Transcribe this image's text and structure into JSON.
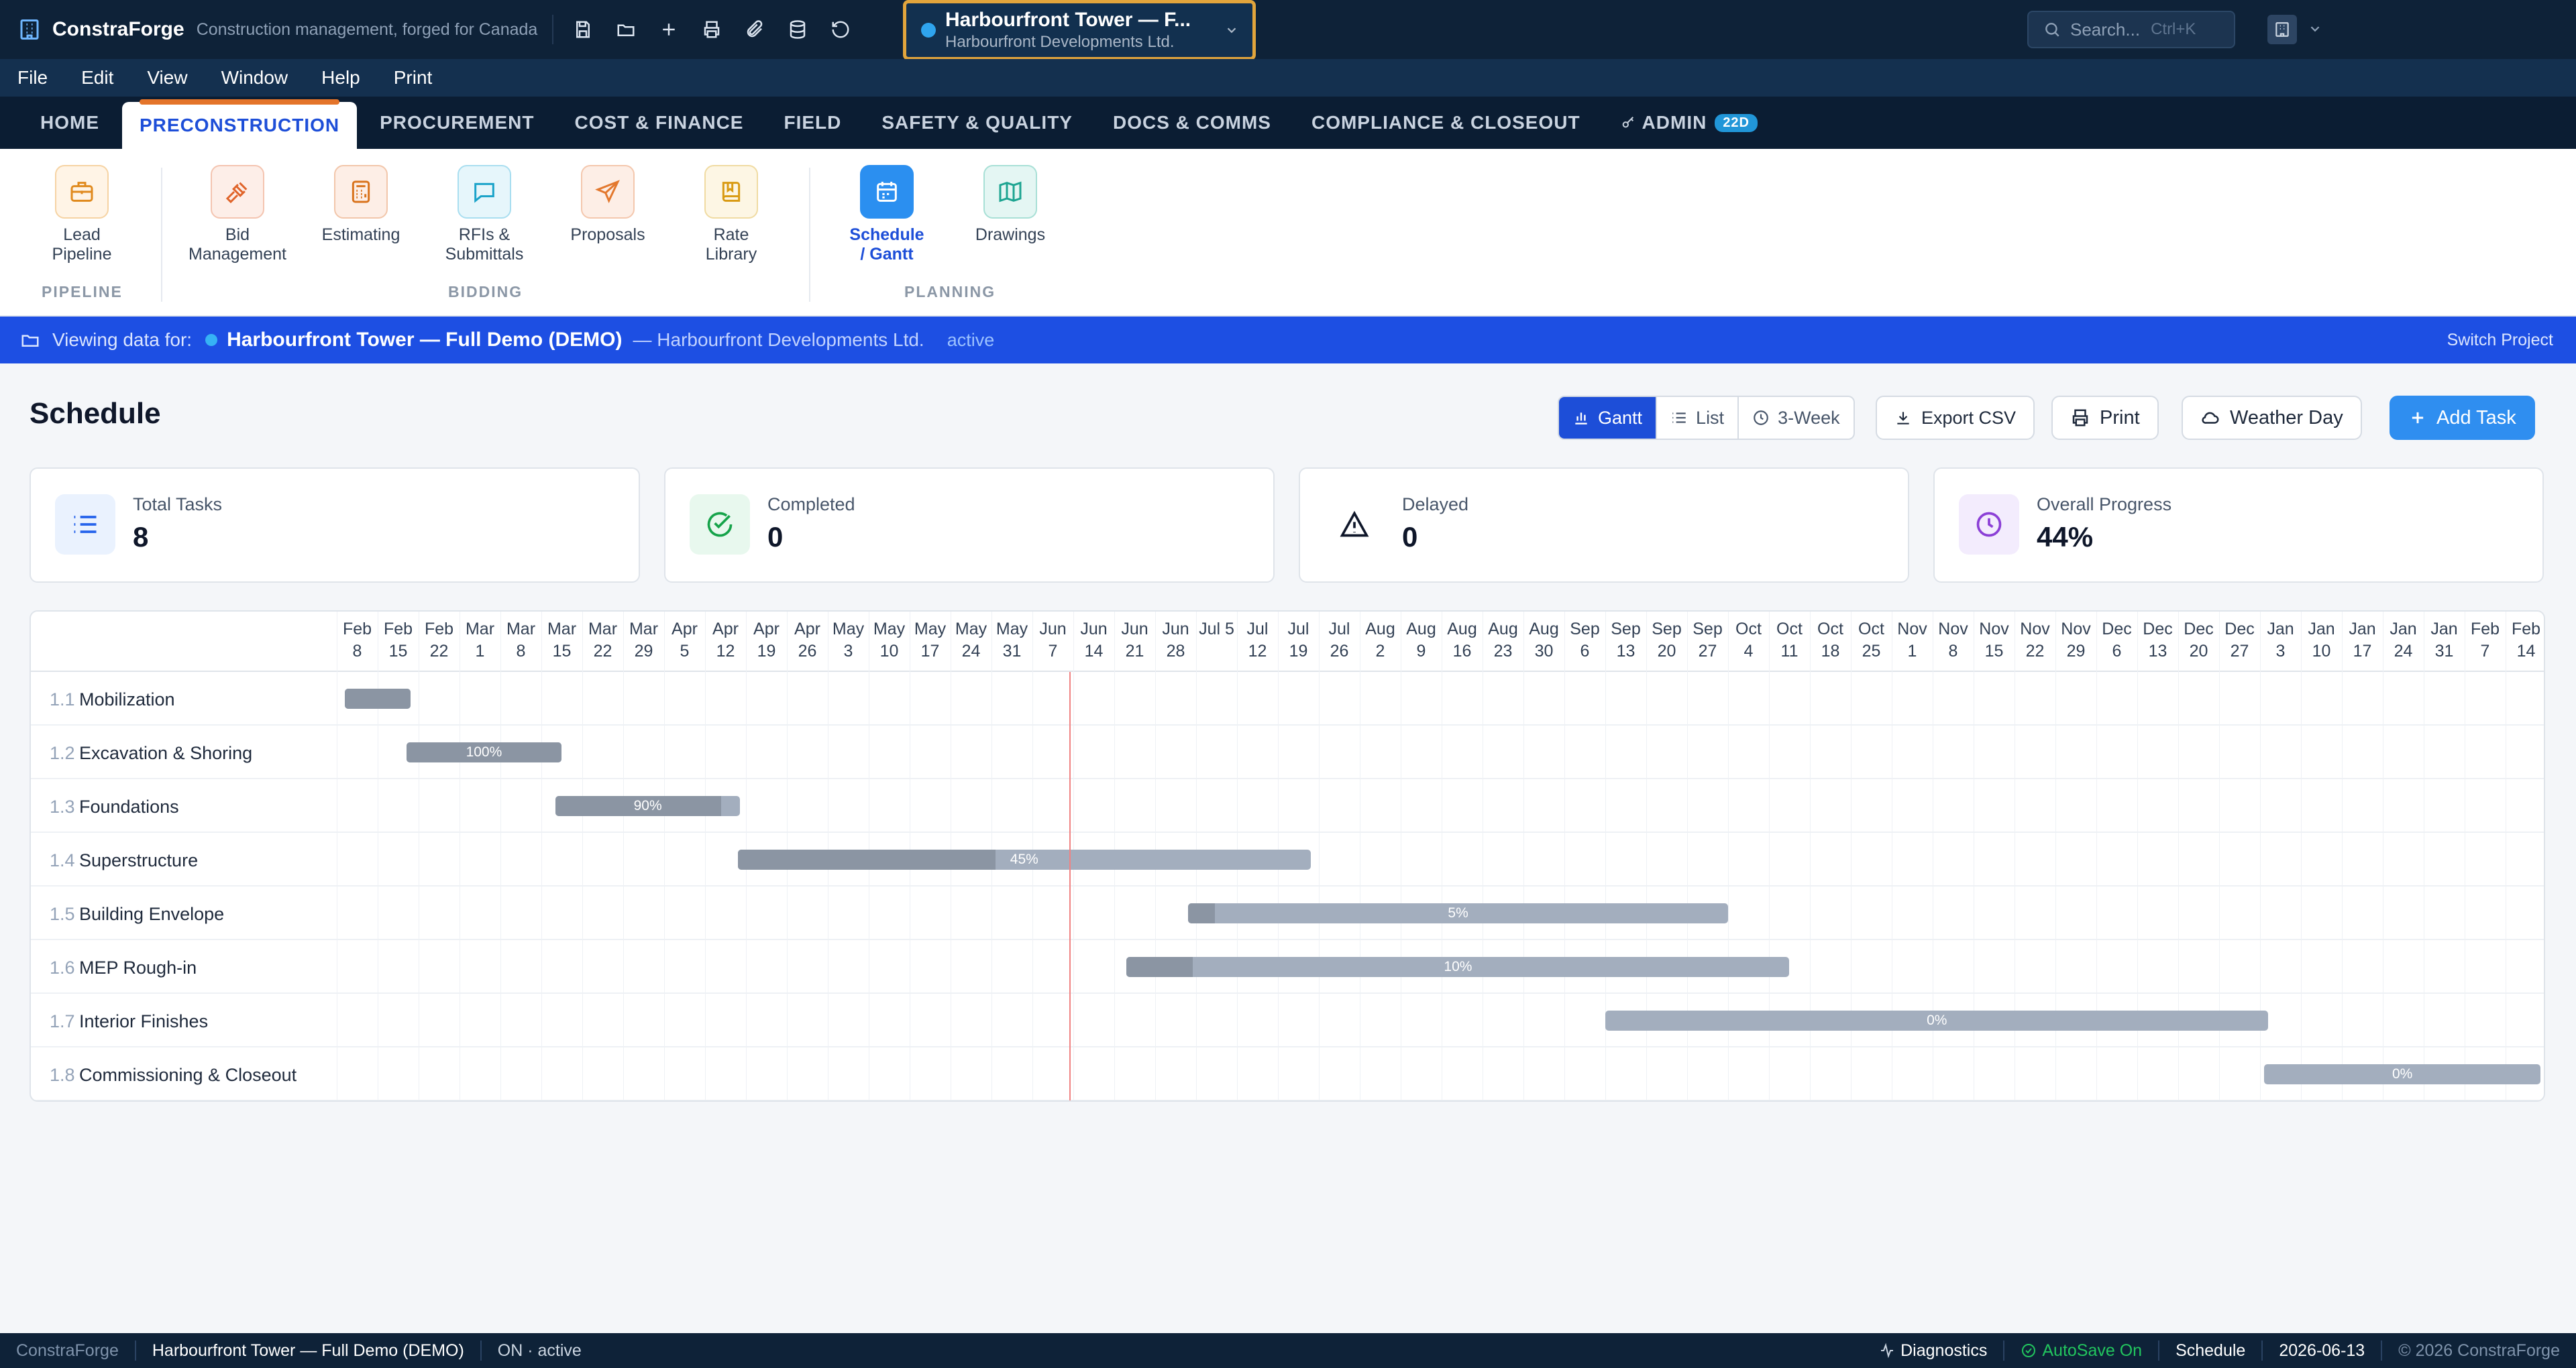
{
  "app": {
    "name": "ConstraForge",
    "tagline": "Construction management, forged for Canada"
  },
  "project_selector": {
    "name": "Harbourfront Tower — F...",
    "client": "Harbourfront Developments Ltd."
  },
  "search": {
    "placeholder": "Search...",
    "shortcut": "Ctrl+K"
  },
  "menu": [
    "File",
    "Edit",
    "View",
    "Window",
    "Help",
    "Print"
  ],
  "tabs": [
    {
      "label": "HOME"
    },
    {
      "label": "PRECONSTRUCTION",
      "active": true
    },
    {
      "label": "PROCUREMENT"
    },
    {
      "label": "COST & FINANCE"
    },
    {
      "label": "FIELD"
    },
    {
      "label": "SAFETY & QUALITY"
    },
    {
      "label": "DOCS & COMMS"
    },
    {
      "label": "COMPLIANCE & CLOSEOUT"
    },
    {
      "label": "ADMIN",
      "badge": "22D"
    }
  ],
  "ribbon": {
    "items": [
      "Lead Pipeline",
      "Bid Management",
      "Estimating",
      "RFIs & Submittals",
      "Proposals",
      "Rate Library",
      "Schedule / Gantt",
      "Drawings"
    ],
    "selected": "Schedule / Gantt",
    "groups": [
      "PIPELINE",
      "BIDDING",
      "PLANNING"
    ]
  },
  "banner": {
    "lead": "Viewing data for:",
    "project": "Harbourfront Tower — Full Demo (DEMO)",
    "client": "— Harbourfront Developments Ltd.",
    "status": "active",
    "switch_label": "Switch Project"
  },
  "page": {
    "title": "Schedule",
    "views": [
      "Gantt",
      "List",
      "3-Week"
    ],
    "active_view": "Gantt",
    "export_label": "Export CSV",
    "print_label": "Print",
    "weather_label": "Weather Day",
    "add_label": "Add Task"
  },
  "stats": [
    {
      "label": "Total Tasks",
      "value": "8"
    },
    {
      "label": "Completed",
      "value": "0"
    },
    {
      "label": "Delayed",
      "value": "0"
    },
    {
      "label": "Overall Progress",
      "value": "44%"
    }
  ],
  "gantt": {
    "dates": [
      [
        "Feb",
        "8"
      ],
      [
        "Feb",
        "15"
      ],
      [
        "Feb",
        "22"
      ],
      [
        "Mar",
        "1"
      ],
      [
        "Mar",
        "8"
      ],
      [
        "Mar",
        "15"
      ],
      [
        "Mar",
        "22"
      ],
      [
        "Mar",
        "29"
      ],
      [
        "Apr",
        "5"
      ],
      [
        "Apr",
        "12"
      ],
      [
        "Apr",
        "19"
      ],
      [
        "Apr",
        "26"
      ],
      [
        "May",
        "3"
      ],
      [
        "May",
        "10"
      ],
      [
        "May",
        "17"
      ],
      [
        "May",
        "24"
      ],
      [
        "May",
        "31"
      ],
      [
        "Jun",
        "7"
      ],
      [
        "Jun",
        "14"
      ],
      [
        "Jun",
        "21"
      ],
      [
        "Jun",
        "28"
      ],
      [
        "Jul 5",
        ""
      ],
      [
        "Jul",
        "12"
      ],
      [
        "Jul",
        "19"
      ],
      [
        "Jul",
        "26"
      ],
      [
        "Aug",
        "2"
      ],
      [
        "Aug",
        "9"
      ],
      [
        "Aug",
        "16"
      ],
      [
        "Aug",
        "23"
      ],
      [
        "Aug",
        "30"
      ],
      [
        "Sep",
        "6"
      ],
      [
        "Sep",
        "13"
      ],
      [
        "Sep",
        "20"
      ],
      [
        "Sep",
        "27"
      ],
      [
        "Oct",
        "4"
      ],
      [
        "Oct",
        "11"
      ],
      [
        "Oct",
        "18"
      ],
      [
        "Oct",
        "25"
      ],
      [
        "Nov",
        "1"
      ],
      [
        "Nov",
        "8"
      ],
      [
        "Nov",
        "15"
      ],
      [
        "Nov",
        "22"
      ],
      [
        "Nov",
        "29"
      ],
      [
        "Dec",
        "6"
      ],
      [
        "Dec",
        "13"
      ],
      [
        "Dec",
        "20"
      ],
      [
        "Dec",
        "27"
      ],
      [
        "Jan",
        "3"
      ],
      [
        "Jan",
        "10"
      ],
      [
        "Jan",
        "17"
      ],
      [
        "Jan",
        "24"
      ],
      [
        "Jan",
        "31"
      ],
      [
        "Feb",
        "7"
      ],
      [
        "Feb",
        "14"
      ]
    ],
    "today_week": 17.9,
    "tasks": [
      {
        "num": "1.1",
        "name": "Mobilization",
        "start_week": 0.2,
        "end_week": 1.8,
        "progress": 1.0,
        "label": ""
      },
      {
        "num": "1.2",
        "name": "Excavation & Shoring",
        "start_week": 1.7,
        "end_week": 5.5,
        "progress": 1.0,
        "label": "100%"
      },
      {
        "num": "1.3",
        "name": "Foundations",
        "start_week": 5.35,
        "end_week": 9.85,
        "progress": 0.9,
        "label": "90%"
      },
      {
        "num": "1.4",
        "name": "Superstructure",
        "start_week": 9.8,
        "end_week": 23.8,
        "progress": 0.45,
        "label": "45%"
      },
      {
        "num": "1.5",
        "name": "Building Envelope",
        "start_week": 20.8,
        "end_week": 34.0,
        "progress": 0.05,
        "label": "5%"
      },
      {
        "num": "1.6",
        "name": "MEP Rough-in",
        "start_week": 19.3,
        "end_week": 35.5,
        "progress": 0.1,
        "label": "10%"
      },
      {
        "num": "1.7",
        "name": "Interior Finishes",
        "start_week": 31.0,
        "end_week": 47.2,
        "progress": 0.0,
        "label": "0%"
      },
      {
        "num": "1.8",
        "name": "Commissioning & Closeout",
        "start_week": 47.1,
        "end_week": 53.85,
        "progress": 0.0,
        "label": "0%"
      }
    ]
  },
  "statusbar": {
    "app": "ConstraForge",
    "project": "Harbourfront Tower — Full Demo (DEMO)",
    "state": "ON · active",
    "diagnostics": "Diagnostics",
    "autosave": "AutoSave On",
    "module": "Schedule",
    "date": "2026-06-13",
    "copyright": "© 2026 ConstraForge"
  },
  "colors": {
    "accent": "#1d4ed8",
    "banner": "#1d4fe3",
    "topbar": "#0e2238",
    "autosave": "#22c55e",
    "today_line": "#f08383"
  }
}
